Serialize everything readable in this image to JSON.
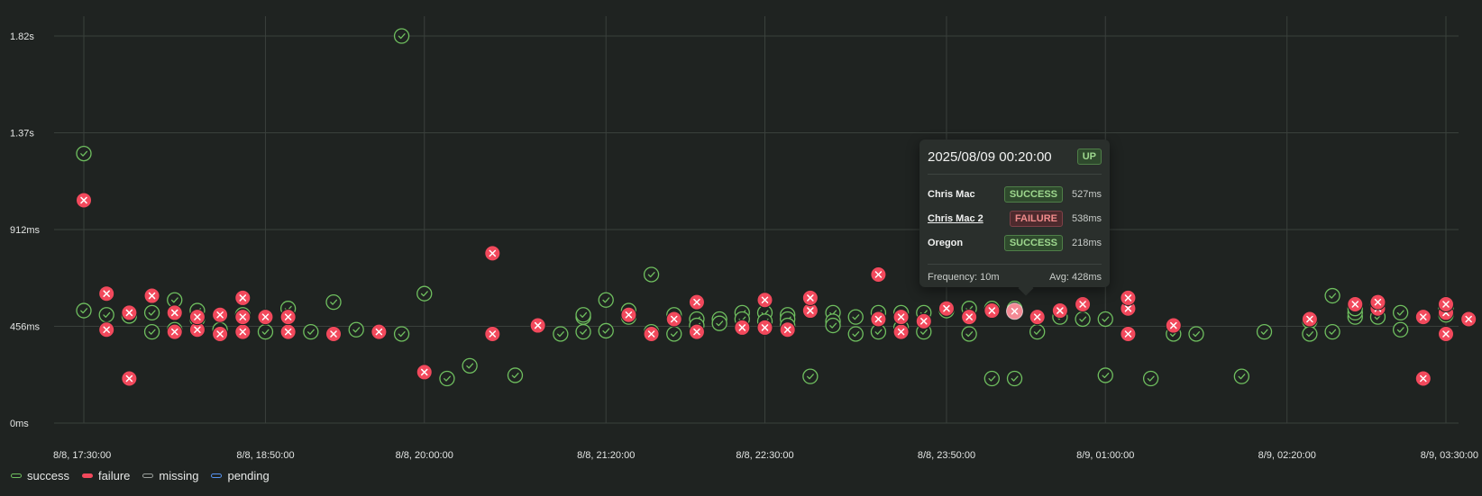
{
  "chart_data": {
    "type": "scatter",
    "y_ticks": [
      {
        "label": "0ms",
        "value": 0
      },
      {
        "label": "456ms",
        "value": 456
      },
      {
        "label": "912ms",
        "value": 912
      },
      {
        "label": "1.37s",
        "value": 1368
      },
      {
        "label": "1.82s",
        "value": 1824
      }
    ],
    "x_ticks": [
      {
        "label": "8/8, 17:30:00",
        "value": 0
      },
      {
        "label": "8/8, 18:50:00",
        "value": 80
      },
      {
        "label": "8/8, 20:00:00",
        "value": 150
      },
      {
        "label": "8/8, 21:20:00",
        "value": 230
      },
      {
        "label": "8/8, 22:30:00",
        "value": 300
      },
      {
        "label": "8/8, 23:50:00",
        "value": 380
      },
      {
        "label": "8/9, 01:00:00",
        "value": 450
      },
      {
        "label": "8/9, 02:20:00",
        "value": 530
      },
      {
        "label": "8/9, 03:30:00",
        "value": 600
      }
    ],
    "x_unit": "minutes since 8/8 17:30",
    "ylim": [
      0,
      1824
    ],
    "grid": true,
    "legend_position": "bottom-left",
    "legend": [
      {
        "name": "success",
        "color": "#6fbf5f"
      },
      {
        "name": "failure",
        "color": "#f2495c"
      },
      {
        "name": "missing",
        "color": "#9aa09c"
      },
      {
        "name": "pending",
        "color": "#5794f2"
      }
    ],
    "series": [
      {
        "name": "success",
        "color": "#6fbf5f",
        "points": [
          [
            0,
            530
          ],
          [
            0,
            1270
          ],
          [
            10,
            510
          ],
          [
            20,
            505
          ],
          [
            30,
            520
          ],
          [
            30,
            430
          ],
          [
            40,
            580
          ],
          [
            40,
            440
          ],
          [
            50,
            530
          ],
          [
            50,
            490
          ],
          [
            60,
            440
          ],
          [
            70,
            510
          ],
          [
            80,
            430
          ],
          [
            90,
            540
          ],
          [
            90,
            430
          ],
          [
            100,
            430
          ],
          [
            110,
            570
          ],
          [
            120,
            440
          ],
          [
            140,
            1824
          ],
          [
            140,
            420
          ],
          [
            150,
            610
          ],
          [
            160,
            210
          ],
          [
            170,
            270
          ],
          [
            190,
            225
          ],
          [
            210,
            420
          ],
          [
            220,
            500
          ],
          [
            220,
            510
          ],
          [
            220,
            430
          ],
          [
            230,
            580
          ],
          [
            230,
            435
          ],
          [
            240,
            530
          ],
          [
            240,
            500
          ],
          [
            250,
            700
          ],
          [
            250,
            430
          ],
          [
            260,
            510
          ],
          [
            260,
            420
          ],
          [
            270,
            490
          ],
          [
            270,
            460
          ],
          [
            280,
            490
          ],
          [
            280,
            470
          ],
          [
            290,
            520
          ],
          [
            290,
            490
          ],
          [
            300,
            520
          ],
          [
            300,
            480
          ],
          [
            310,
            510
          ],
          [
            310,
            490
          ],
          [
            310,
            460
          ],
          [
            320,
            220
          ],
          [
            330,
            520
          ],
          [
            330,
            480
          ],
          [
            330,
            460
          ],
          [
            340,
            500
          ],
          [
            340,
            420
          ],
          [
            350,
            520
          ],
          [
            350,
            430
          ],
          [
            360,
            520
          ],
          [
            360,
            450
          ],
          [
            370,
            520
          ],
          [
            370,
            430
          ],
          [
            380,
            530
          ],
          [
            390,
            540
          ],
          [
            390,
            420
          ],
          [
            400,
            540
          ],
          [
            400,
            210
          ],
          [
            410,
            540
          ],
          [
            410,
            210
          ],
          [
            420,
            430
          ],
          [
            430,
            500
          ],
          [
            440,
            490
          ],
          [
            450,
            490
          ],
          [
            450,
            225
          ],
          [
            470,
            210
          ],
          [
            480,
            420
          ],
          [
            490,
            420
          ],
          [
            510,
            220
          ],
          [
            520,
            430
          ],
          [
            540,
            480
          ],
          [
            540,
            420
          ],
          [
            550,
            600
          ],
          [
            550,
            430
          ],
          [
            560,
            500
          ],
          [
            560,
            520
          ],
          [
            560,
            540
          ],
          [
            570,
            560
          ],
          [
            570,
            500
          ],
          [
            580,
            520
          ],
          [
            580,
            440
          ],
          [
            600,
            510
          ],
          [
            600,
            540
          ]
        ]
      },
      {
        "name": "failure",
        "color": "#f2495c",
        "points": [
          [
            0,
            1050
          ],
          [
            10,
            610
          ],
          [
            10,
            440
          ],
          [
            20,
            210
          ],
          [
            20,
            520
          ],
          [
            30,
            600
          ],
          [
            40,
            520
          ],
          [
            40,
            430
          ],
          [
            50,
            440
          ],
          [
            50,
            500
          ],
          [
            60,
            420
          ],
          [
            60,
            510
          ],
          [
            70,
            590
          ],
          [
            70,
            430
          ],
          [
            70,
            500
          ],
          [
            80,
            500
          ],
          [
            90,
            430
          ],
          [
            90,
            500
          ],
          [
            110,
            420
          ],
          [
            130,
            430
          ],
          [
            150,
            240
          ],
          [
            180,
            800
          ],
          [
            180,
            420
          ],
          [
            200,
            460
          ],
          [
            240,
            510
          ],
          [
            250,
            420
          ],
          [
            260,
            490
          ],
          [
            270,
            570
          ],
          [
            270,
            430
          ],
          [
            290,
            450
          ],
          [
            300,
            450
          ],
          [
            300,
            580
          ],
          [
            310,
            440
          ],
          [
            320,
            530
          ],
          [
            320,
            590
          ],
          [
            350,
            490
          ],
          [
            350,
            700
          ],
          [
            360,
            430
          ],
          [
            360,
            500
          ],
          [
            370,
            480
          ],
          [
            380,
            540
          ],
          [
            390,
            500
          ],
          [
            400,
            530
          ],
          [
            410,
            527
          ],
          [
            420,
            500
          ],
          [
            430,
            530
          ],
          [
            440,
            560
          ],
          [
            460,
            540
          ],
          [
            460,
            590
          ],
          [
            460,
            420
          ],
          [
            480,
            460
          ],
          [
            540,
            490
          ],
          [
            560,
            560
          ],
          [
            570,
            540
          ],
          [
            570,
            570
          ],
          [
            590,
            500
          ],
          [
            590,
            210
          ],
          [
            600,
            520
          ],
          [
            600,
            560
          ],
          [
            600,
            420
          ],
          [
            610,
            490
          ]
        ]
      }
    ]
  },
  "tooltip": {
    "title": "2025/08/09 00:20:00",
    "status_badge": "UP",
    "rows": [
      {
        "name": "Chris Mac",
        "status": "SUCCESS",
        "ms": "527ms"
      },
      {
        "name": "Chris Mac 2",
        "status": "FAILURE",
        "ms": "538ms"
      },
      {
        "name": "Oregon",
        "status": "SUCCESS",
        "ms": "218ms"
      }
    ],
    "frequency": "Frequency: 10m",
    "avg": "Avg: 428ms"
  }
}
